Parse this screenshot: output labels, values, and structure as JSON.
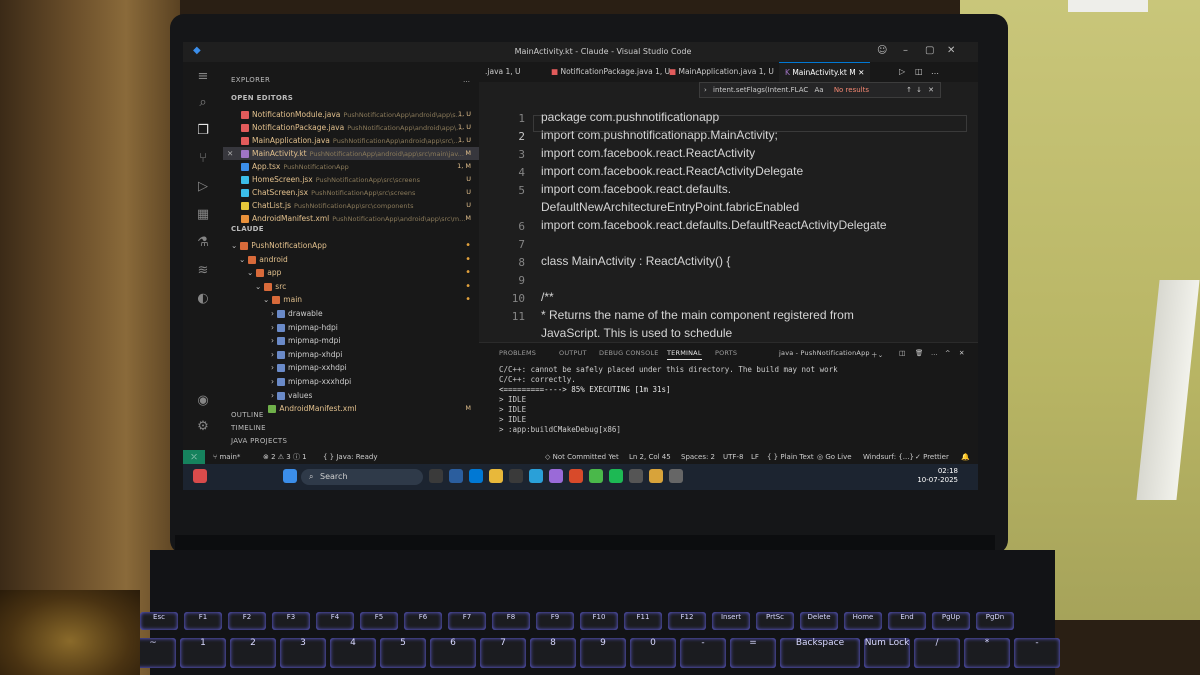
{
  "window": {
    "title": "MainActivity.kt - Claude - Visual Studio Code"
  },
  "sidebar": {
    "explorer_label": "EXPLORER",
    "open_editors_label": "OPEN EDITORS",
    "open_editors": [
      {
        "name": "NotificationModule.java",
        "path": "PushNotificationApp\\android\\app\\s...",
        "badge": "1, U"
      },
      {
        "name": "NotificationPackage.java",
        "path": "PushNotificationApp\\android\\app\\...",
        "badge": "1, U"
      },
      {
        "name": "MainApplication.java",
        "path": "PushNotificationApp\\android\\app\\src\\...",
        "badge": "1, U"
      },
      {
        "name": "MainActivity.kt",
        "path": "PushNotificationApp\\android\\app\\src\\main\\jav...",
        "badge": "M"
      },
      {
        "name": "App.tsx",
        "path": "PushNotificationApp",
        "badge": "1, M"
      },
      {
        "name": "HomeScreen.jsx",
        "path": "PushNotificationApp\\src\\screens",
        "badge": "U"
      },
      {
        "name": "ChatScreen.jsx",
        "path": "PushNotificationApp\\src\\screens",
        "badge": "U"
      },
      {
        "name": "ChatList.js",
        "path": "PushNotificationApp\\src\\components",
        "badge": "U"
      },
      {
        "name": "AndroidManifest.xml",
        "path": "PushNotificationApp\\android\\app\\src\\m...",
        "badge": "M"
      }
    ],
    "workspace_label": "CLAUDE",
    "tree": [
      {
        "name": "PushNotificationApp",
        "indent": 1
      },
      {
        "name": "android",
        "indent": 2
      },
      {
        "name": "app",
        "indent": 3
      },
      {
        "name": "src",
        "indent": 4
      },
      {
        "name": "main",
        "indent": 5
      },
      {
        "name": "drawable",
        "indent": 6
      },
      {
        "name": "mipmap-hdpi",
        "indent": 6
      },
      {
        "name": "mipmap-mdpi",
        "indent": 6
      },
      {
        "name": "mipmap-xhdpi",
        "indent": 6
      },
      {
        "name": "mipmap-xxhdpi",
        "indent": 6
      },
      {
        "name": "mipmap-xxxhdpi",
        "indent": 6
      },
      {
        "name": "values",
        "indent": 6
      },
      {
        "name": "AndroidManifest.xml",
        "indent": 5,
        "badge": "M"
      }
    ],
    "outline_label": "OUTLINE",
    "timeline_label": "TIMELINE",
    "java_projects_label": "JAVA PROJECTS"
  },
  "tabs": [
    {
      "label": ".java 1, U"
    },
    {
      "label": "NotificationPackage.java 1, U"
    },
    {
      "label": "MainApplication.java 1, U"
    },
    {
      "label": "MainActivity.kt M"
    }
  ],
  "find": {
    "query": "intent.setFlags(Intent.FLAC",
    "options": "Aa",
    "result": "No results"
  },
  "editor": {
    "lines": [
      {
        "num": "1",
        "text": "package com.pushnotificationapp"
      },
      {
        "num": "2",
        "text": "import com.pushnotificationapp.MainActivity;"
      },
      {
        "num": "3",
        "text": "import com.facebook.react.ReactActivity"
      },
      {
        "num": "4",
        "text": "import com.facebook.react.ReactActivityDelegate"
      },
      {
        "num": "5",
        "text": "import com.facebook.react.defaults."
      },
      {
        "num": "",
        "text": "DefaultNewArchitectureEntryPoint.fabricEnabled"
      },
      {
        "num": "6",
        "text": "import com.facebook.react.defaults.DefaultReactActivityDelegate"
      },
      {
        "num": "7",
        "text": ""
      },
      {
        "num": "8",
        "text": "class MainActivity : ReactActivity() {"
      },
      {
        "num": "9",
        "text": ""
      },
      {
        "num": "10",
        "text": "  /**"
      },
      {
        "num": "11",
        "text": "   * Returns the name of the main component registered from"
      },
      {
        "num": "",
        "text": "   JavaScript. This is used to schedule"
      },
      {
        "num": "12",
        "text": "   * rendering of the component."
      },
      {
        "num": "13",
        "text": "   */"
      }
    ]
  },
  "panel": {
    "tabs": [
      "PROBLEMS",
      "OUTPUT",
      "DEBUG CONSOLE",
      "TERMINAL",
      "PORTS"
    ],
    "problems_count": "",
    "terminal_name": "java - PushNotificationApp",
    "terminal_lines": [
      "C/C++:  cannot be safely placed under this directory.  The build may not work",
      "C/C++:  correctly.",
      "<=========----> 85% EXECUTING [1m 31s]",
      "> IDLE",
      "> IDLE",
      "> IDLE",
      "> :app:buildCMakeDebug[x86]"
    ]
  },
  "status": {
    "branch": "main*",
    "problems": "⊗ 2 ⚠ 3 ⓘ 1",
    "java": "Java: Ready",
    "git": "Not Committed Yet",
    "position": "Ln 2, Col 45",
    "spaces": "Spaces: 2",
    "encoding": "UTF-8",
    "eol": "LF",
    "language": "{ } Plain Text",
    "golive": "Go Live",
    "windsurf": "Windsurf: {...}",
    "prettier": "Prettier"
  },
  "taskbar": {
    "search_placeholder": "Search",
    "time": "02:18",
    "date": "10-07-2025"
  },
  "keyboard": {
    "row_fn": [
      "Esc",
      "F1",
      "F2",
      "F3",
      "F4",
      "F5",
      "F6",
      "F7",
      "F8",
      "F9",
      "F10",
      "F11",
      "F12",
      "Insert",
      "PrtSc",
      "Delete",
      "Home",
      "End",
      "PgUp",
      "PgDn"
    ],
    "row_num": [
      "~",
      "1",
      "2",
      "3",
      "4",
      "5",
      "6",
      "7",
      "8",
      "9",
      "0",
      "-",
      "=",
      "Backspace",
      "Num Lock",
      "/",
      "*",
      "-"
    ]
  },
  "colors": {
    "accent": "#0078d4",
    "modified": "#e2c08d",
    "remote": "#16825d"
  }
}
